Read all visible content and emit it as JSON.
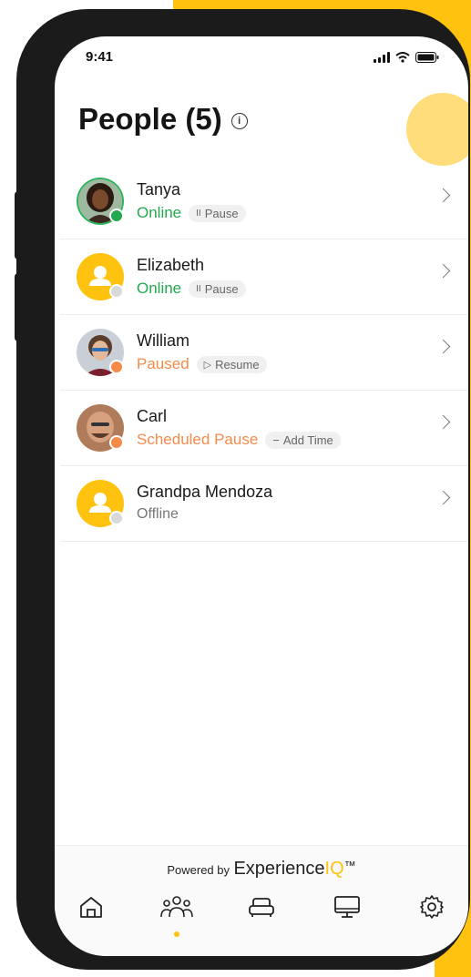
{
  "status_bar": {
    "time": "9:41"
  },
  "header": {
    "title": "People (5)",
    "info_glyph": "i"
  },
  "people": [
    {
      "name": "Tanya",
      "status": "Online",
      "status_color": "#22a94f",
      "action_icon": "pause-icon",
      "action_glyph": "II",
      "action_label": "Pause",
      "avatar": "photo",
      "dot_color": "#22a94f"
    },
    {
      "name": "Elizabeth",
      "status": "Online",
      "status_color": "#22a94f",
      "action_icon": "pause-icon",
      "action_glyph": "II",
      "action_label": "Pause",
      "avatar": "user-icon",
      "dot_color": "#d9d9d9"
    },
    {
      "name": "William",
      "status": "Paused",
      "status_color": "#F58B4B",
      "action_icon": "play-icon",
      "action_glyph": "▷",
      "action_label": "Resume",
      "avatar": "photo",
      "dot_color": "#F58B4B"
    },
    {
      "name": "Carl",
      "status": "Scheduled Pause",
      "status_color": "#F58B4B",
      "action_icon": "minus-icon",
      "action_glyph": "−",
      "action_label": "Add Time",
      "avatar": "photo",
      "dot_color": "#F58B4B"
    },
    {
      "name": "Grandpa Mendoza",
      "status": "Offline",
      "status_color": "#777777",
      "avatar": "user-icon",
      "dot_color": "#d9d9d9"
    }
  ],
  "footer": {
    "powered_by": "Powered by",
    "brand_prefix": "Experience",
    "brand_suffix": "IQ",
    "brand_tm": "™"
  },
  "nav": [
    {
      "icon": "home-icon",
      "active": false
    },
    {
      "icon": "people-icon",
      "active": true
    },
    {
      "icon": "couch-icon",
      "active": false
    },
    {
      "icon": "monitor-icon",
      "active": false
    },
    {
      "icon": "gear-icon",
      "active": false
    }
  ],
  "colors": {
    "accent": "#FFC20E",
    "online": "#22a94f",
    "paused": "#F58B4B"
  }
}
